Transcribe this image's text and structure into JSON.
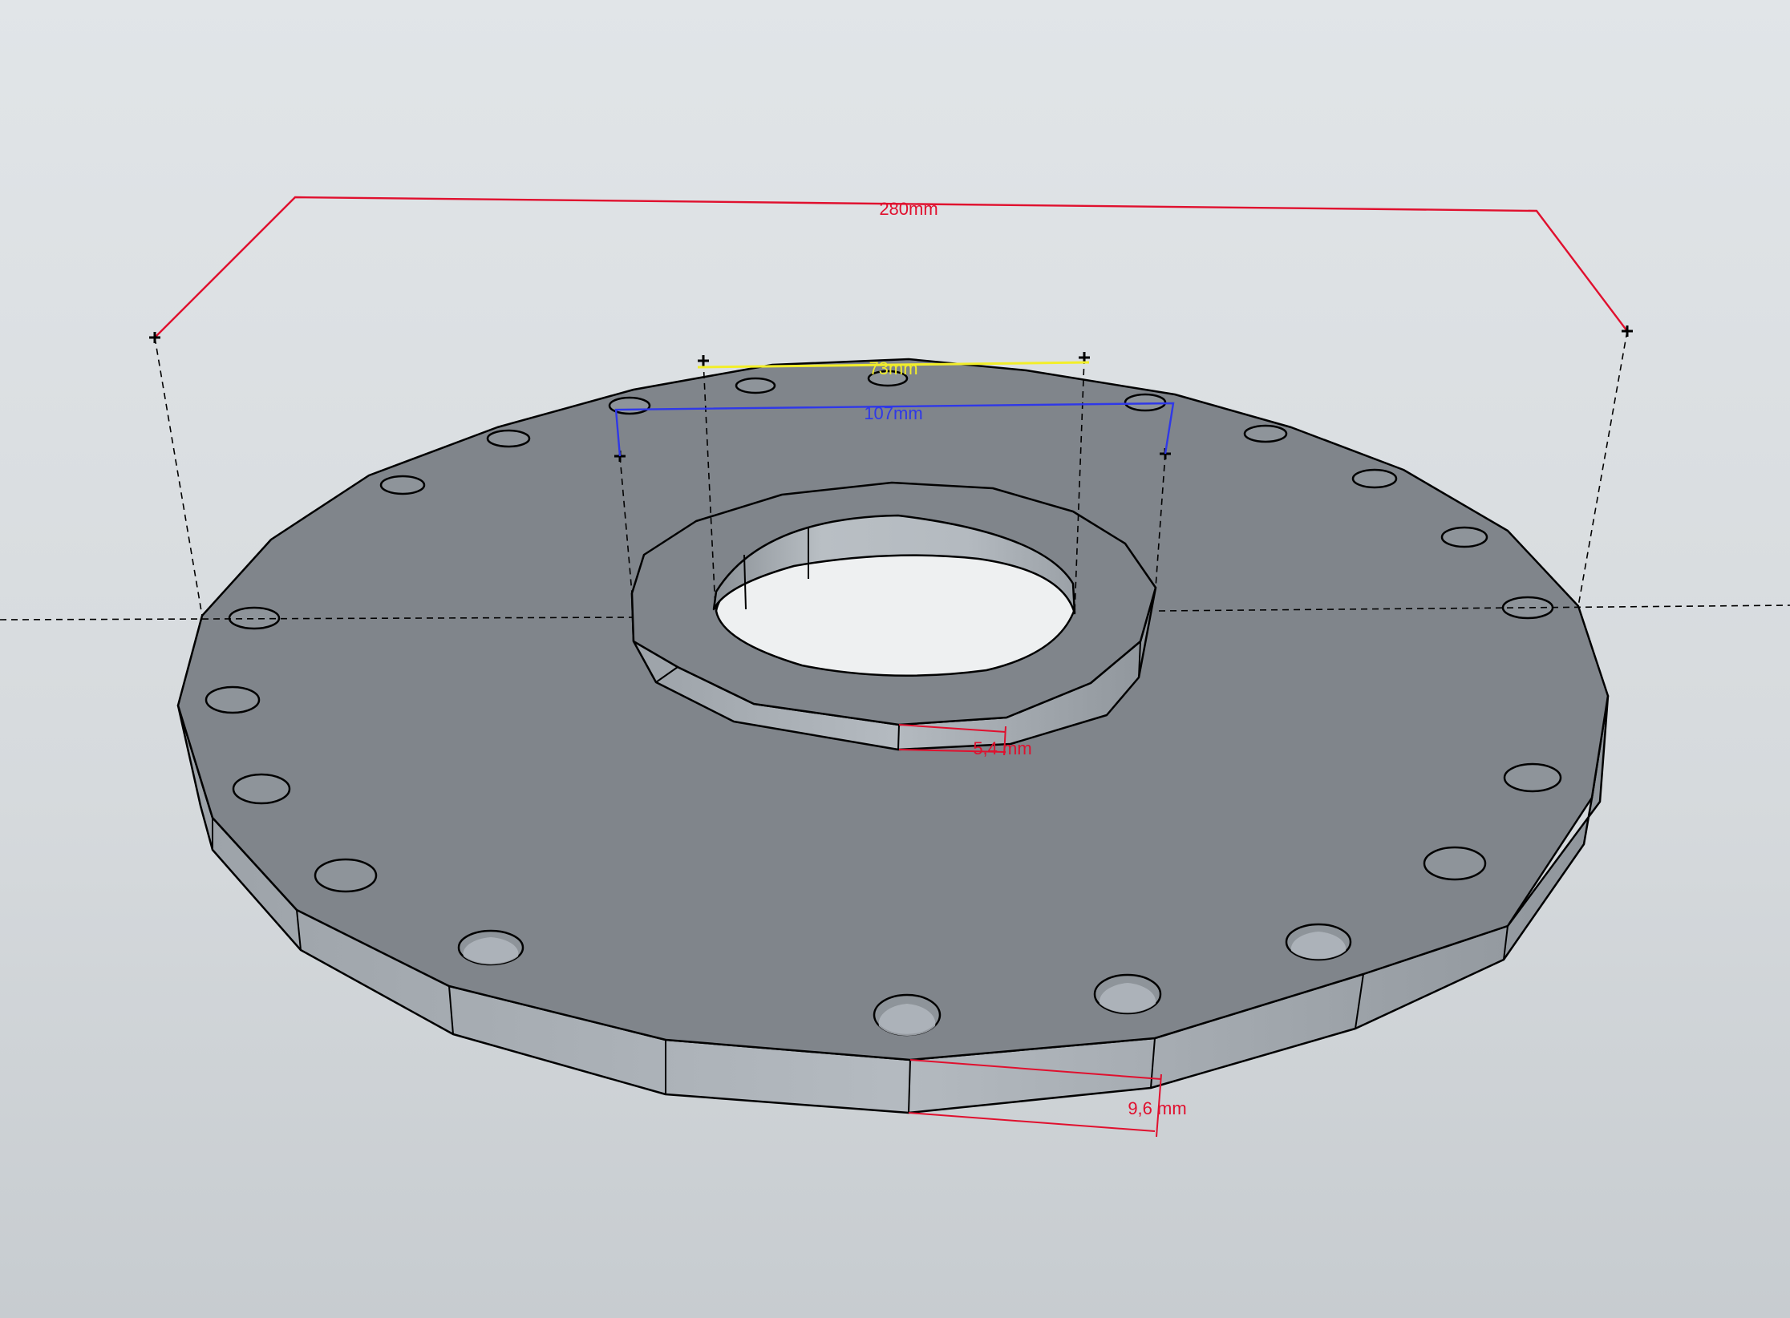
{
  "scene": {
    "background_top": "#e1e5e8",
    "background_bottom": "#c7ccd0",
    "face_color": "#80858b",
    "side_color": "#aeb4ba",
    "hole_color": "#8e949a",
    "edge_color": "#000000"
  },
  "dimensions": {
    "outer_diameter": {
      "label": "280mm",
      "color": "#e0102e"
    },
    "hub_inner_diameter": {
      "label": "73mm",
      "color": "#f2ee2a"
    },
    "hub_outer_diameter": {
      "label": "107mm",
      "color": "#2f38e8"
    },
    "hub_thickness": {
      "label": "5,4 mm",
      "color": "#e0102e"
    },
    "flange_thickness": {
      "label": "9,6 mm",
      "color": "#e0102e"
    }
  }
}
